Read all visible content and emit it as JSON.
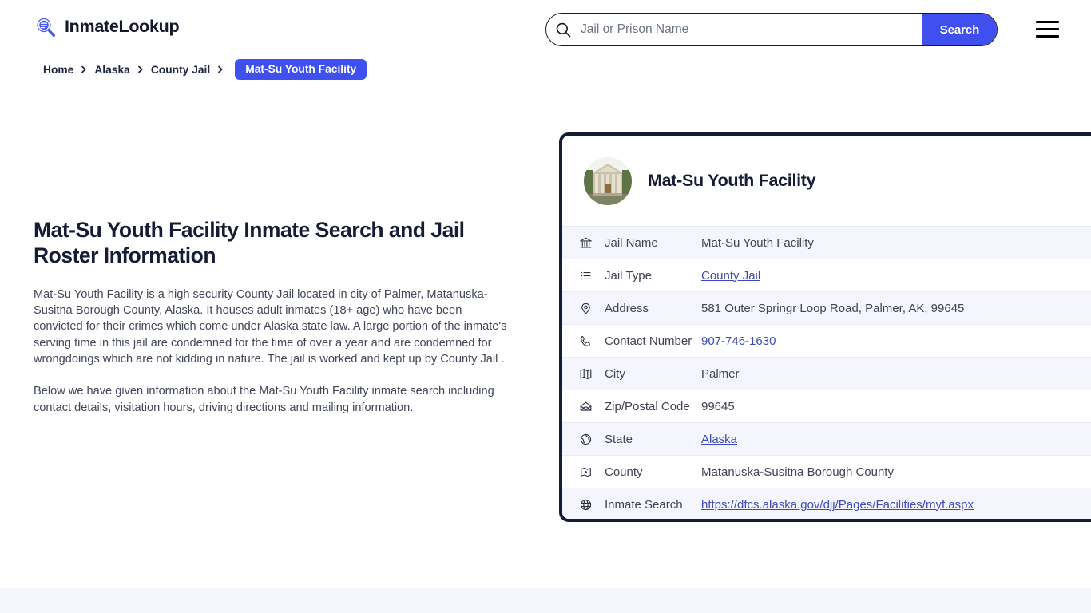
{
  "header": {
    "brand_name": "InmateLookup",
    "brand_icon": "search-logo-icon",
    "menu_icon": "hamburger-menu-icon"
  },
  "search": {
    "icon": "search-icon",
    "placeholder": "Jail or Prison Name",
    "value": "",
    "button_label": "Search"
  },
  "breadcrumb": {
    "items": [
      {
        "label": "Home",
        "current": false
      },
      {
        "label": "Alaska",
        "current": false
      },
      {
        "label": "County Jail",
        "current": false
      },
      {
        "label": "Mat-Su Youth Facility",
        "current": true
      }
    ],
    "separator_icon": "chevron-right-icon"
  },
  "main": {
    "title": "Mat-Su Youth Facility Inmate Search and Jail Roster Information",
    "paragraphs": [
      "Mat-Su Youth Facility is a high security County Jail located in city of Palmer, Matanuska-Susitna Borough County, Alaska. It houses adult inmates (18+ age) who have been convicted for their crimes which come under Alaska state law. A large portion of the inmate's serving time in this jail are condemned for the time of over a year and are condemned for wrongdoings which are not kidding in nature. The jail is worked and kept up by County Jail .",
      "Below we have given information about the Mat-Su Youth Facility inmate search including contact details, visitation hours, driving directions and mailing information."
    ]
  },
  "info_card": {
    "avatar_icon": "facility-building-photo",
    "facility_name": "Mat-Su Youth Facility",
    "rows": [
      {
        "icon": "bank-icon",
        "label": "Jail Name",
        "value": "Mat-Su Youth Facility",
        "link": false
      },
      {
        "icon": "list-icon",
        "label": "Jail Type",
        "value": "County Jail",
        "link": true
      },
      {
        "icon": "map-pin-icon",
        "label": "Address",
        "value": "581 Outer Springr Loop Road, Palmer, AK, 99645",
        "link": false
      },
      {
        "icon": "phone-icon",
        "label": "Contact Number",
        "value": "907-746-1630",
        "link": true
      },
      {
        "icon": "map-icon",
        "label": "City",
        "value": "Palmer",
        "link": false
      },
      {
        "icon": "envelope-icon",
        "label": "Zip/Postal Code",
        "value": "99645",
        "link": false
      },
      {
        "icon": "globe-pin-icon",
        "label": "State",
        "value": "Alaska",
        "link": true
      },
      {
        "icon": "county-tag-icon",
        "label": "County",
        "value": "Matanuska-Susitna Borough County",
        "link": false
      },
      {
        "icon": "globe-icon",
        "label": "Inmate Search",
        "value": "https://dfcs.alaska.gov/djj/Pages/Facilities/myf.aspx",
        "link": true
      }
    ]
  },
  "colors": {
    "accent": "#4050f0",
    "card_border": "#141d35",
    "link": "#3d4bb8",
    "row_stripe": "#f5f6fd",
    "footer_band": "#f6f6fd",
    "heading": "#161c36"
  }
}
